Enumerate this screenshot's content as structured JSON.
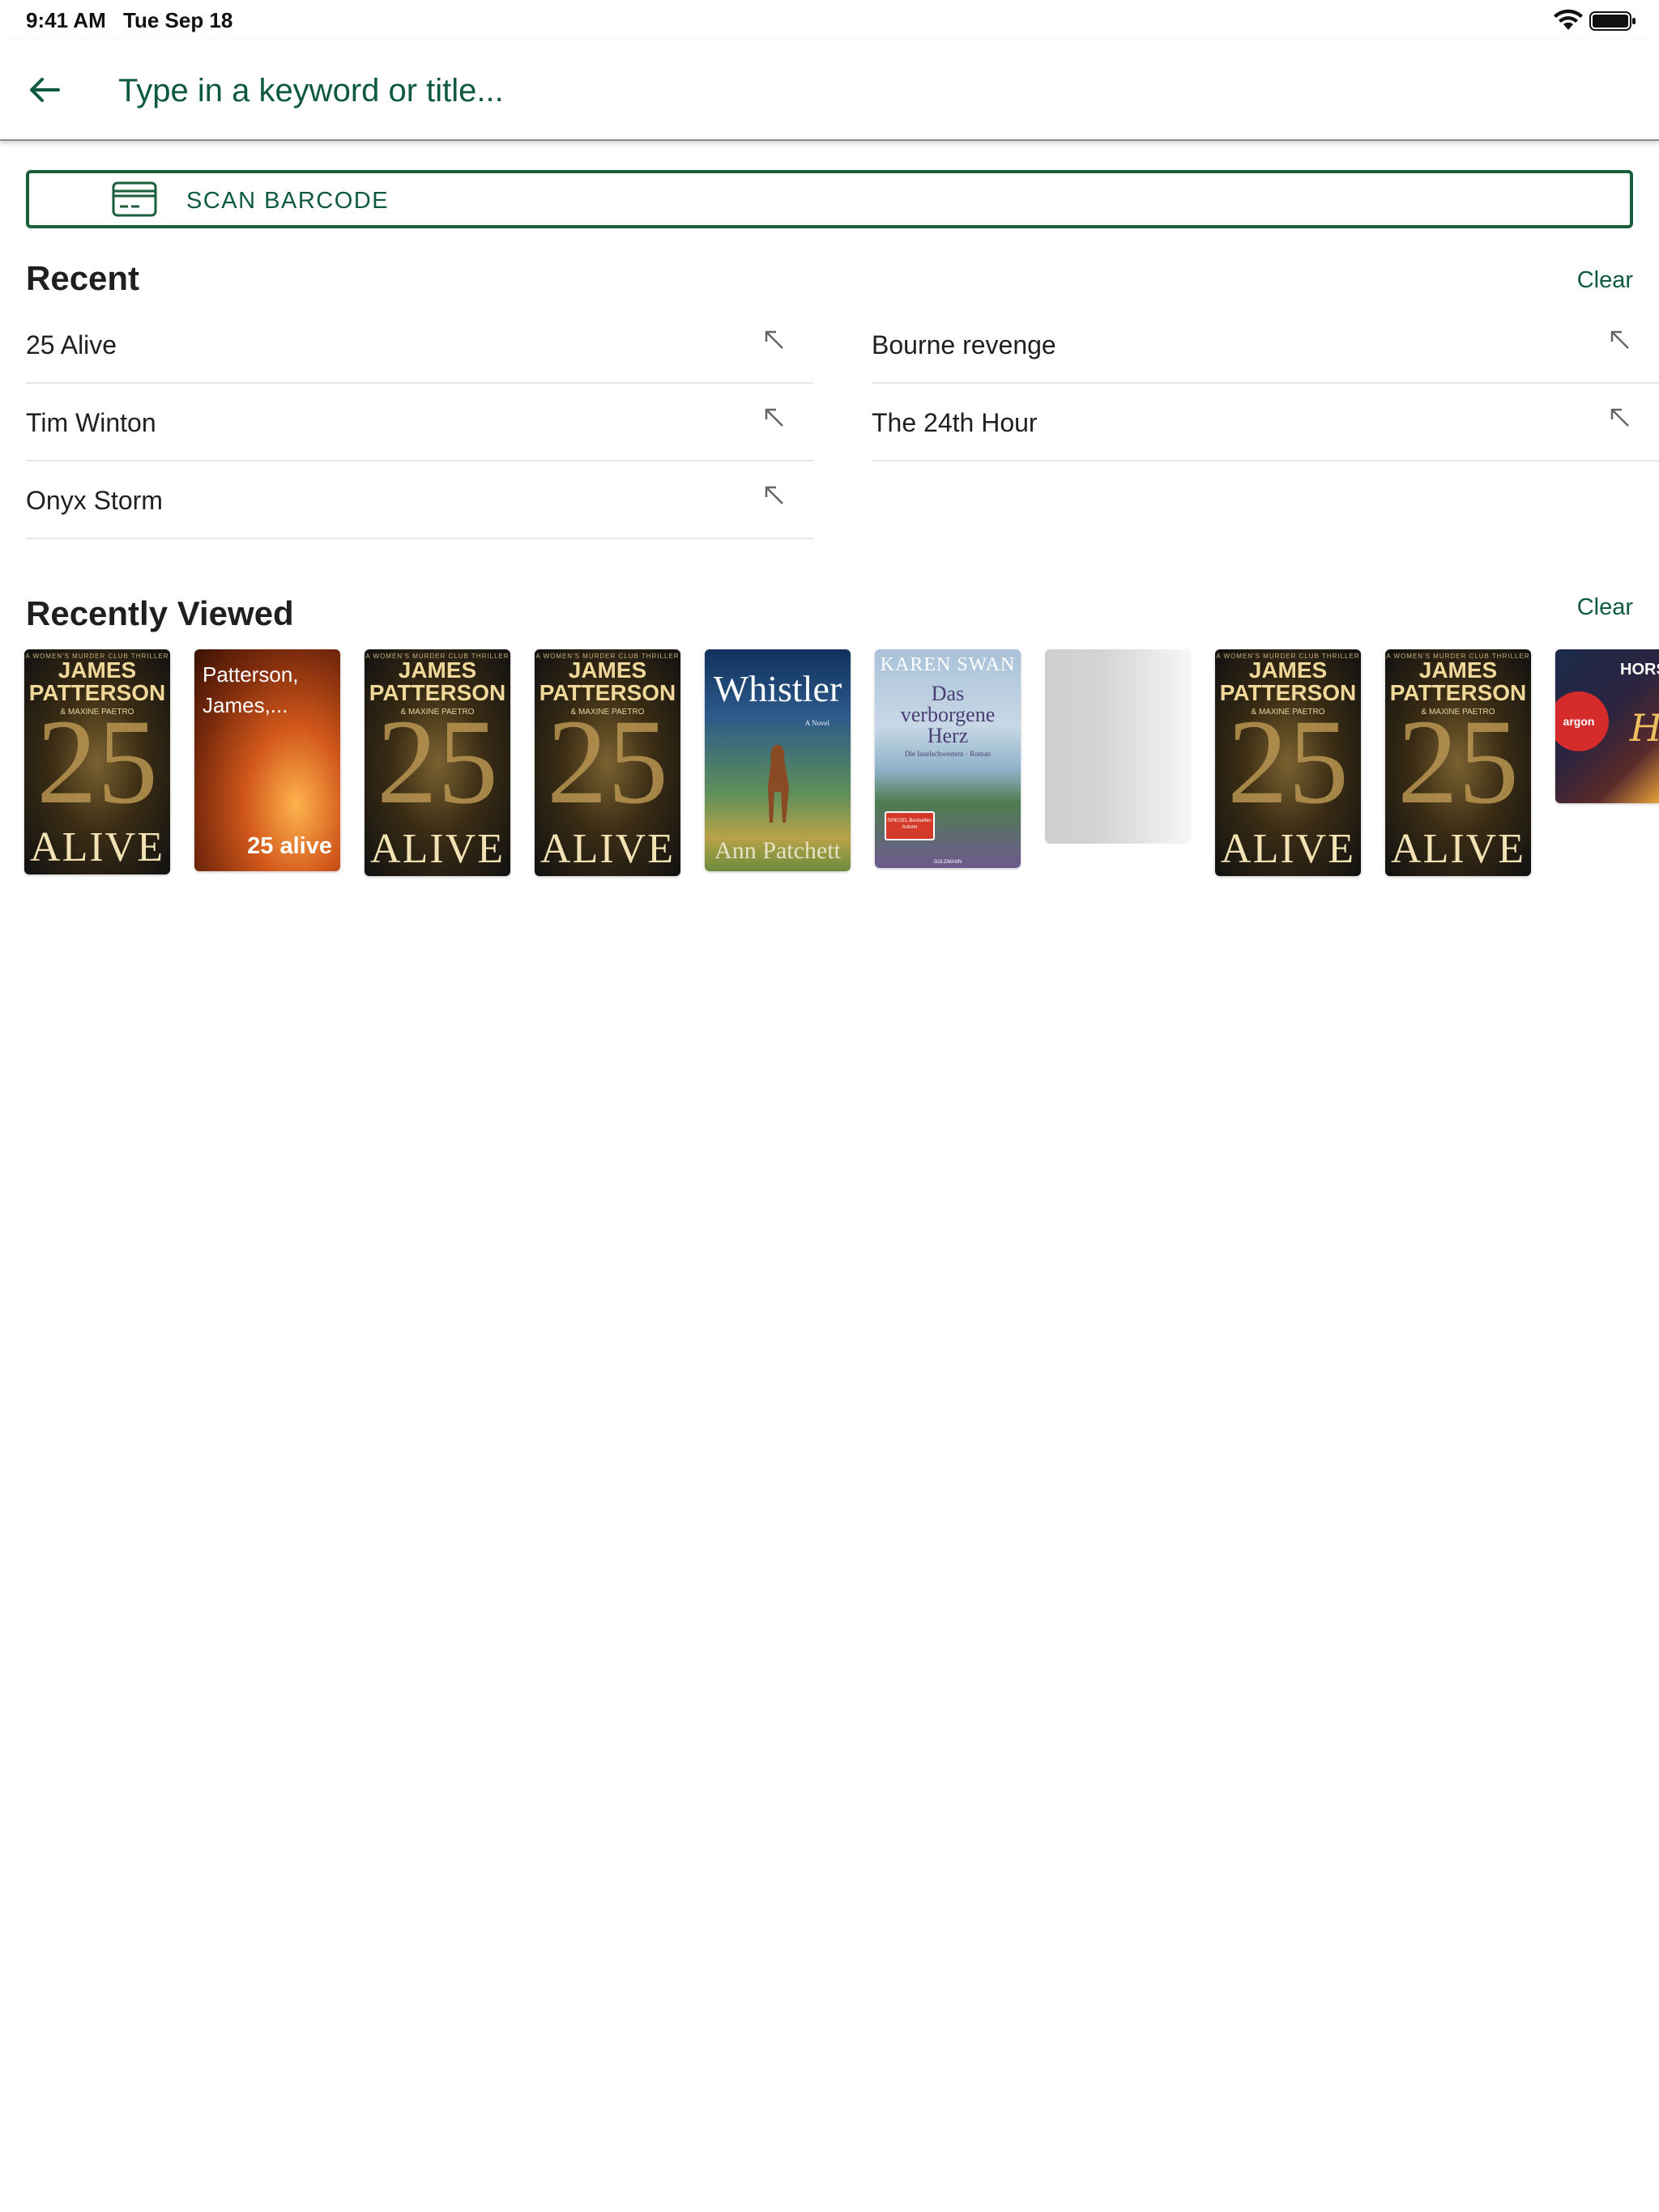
{
  "status_bar": {
    "time": "9:41 AM",
    "date": "Tue Sep 18",
    "icons": [
      "wifi-icon",
      "battery-icon"
    ]
  },
  "search": {
    "placeholder": "Type in a keyword or title...",
    "value": "",
    "back_icon": "arrow-left-icon"
  },
  "scan_barcode": {
    "label": "SCAN BARCODE",
    "icon": "card-icon"
  },
  "recent": {
    "title": "Recent",
    "clear_label": "Clear",
    "items": [
      "25 Alive",
      "Bourne revenge",
      "Tim Winton",
      "The 24th Hour",
      "Onyx Storm"
    ],
    "item_icon": "arrow-up-left-icon"
  },
  "recently_viewed": {
    "title": "Recently Viewed",
    "clear_label": "Clear",
    "books": [
      {
        "style": "dark",
        "small_top": "A WOMEN'S MURDER CLUB THRILLER",
        "author_line1": "JAMES",
        "author_line2": "PATTERSON",
        "coauthor": "& MAXINE PAETRO",
        "number": "25",
        "title": "ALIVE"
      },
      {
        "style": "orange",
        "author_line1": "Patterson,",
        "author_line2": "James,...",
        "title": "25 alive"
      },
      {
        "style": "dark",
        "small_top": "A WOMEN'S MURDER CLUB THRILLER",
        "author_line1": "JAMES",
        "author_line2": "PATTERSON",
        "coauthor": "& MAXINE PAETRO",
        "number": "25",
        "title": "ALIVE"
      },
      {
        "style": "dark",
        "small_top": "A WOMEN'S MURDER CLUB THRILLER",
        "author_line1": "JAMES",
        "author_line2": "PATTERSON",
        "coauthor": "& MAXINE PAETRO",
        "number": "25",
        "title": "ALIVE"
      },
      {
        "style": "whistler",
        "title": "Whistler",
        "subtitle": "A Novel",
        "author": "Ann Patchett"
      },
      {
        "style": "swan",
        "author": "KAREN SWAN",
        "title_line1": "Das",
        "title_line2": "verborgene",
        "title_line3": "Herz",
        "subtitle": "Die Inselschwestern · Roman",
        "badge": "SPIEGEL Bestseller-Autorin",
        "publisher": "GOLDMANN"
      },
      {
        "style": "placeholder"
      },
      {
        "style": "dark",
        "small_top": "A WOMEN'S MURDER CLUB THRILLER",
        "author_line1": "JAMES",
        "author_line2": "PATTERSON",
        "coauthor": "& MAXINE PAETRO",
        "number": "25",
        "title": "ALIVE"
      },
      {
        "style": "dark",
        "small_top": "A WOMEN'S MURDER CLUB THRILLER",
        "author_line1": "JAMES",
        "author_line2": "PATTERSON",
        "coauthor": "& MAXINE PAETRO",
        "number": "25",
        "title": "ALIVE"
      },
      {
        "style": "horst",
        "author": "HORST",
        "publisher": "argon",
        "script": "Hor Joa"
      }
    ]
  },
  "colors": {
    "brand_green": "#0d5a3f",
    "border_green": "#1a5e3c",
    "text_dark": "#1f1f1f",
    "divider": "#e6e6e6"
  }
}
